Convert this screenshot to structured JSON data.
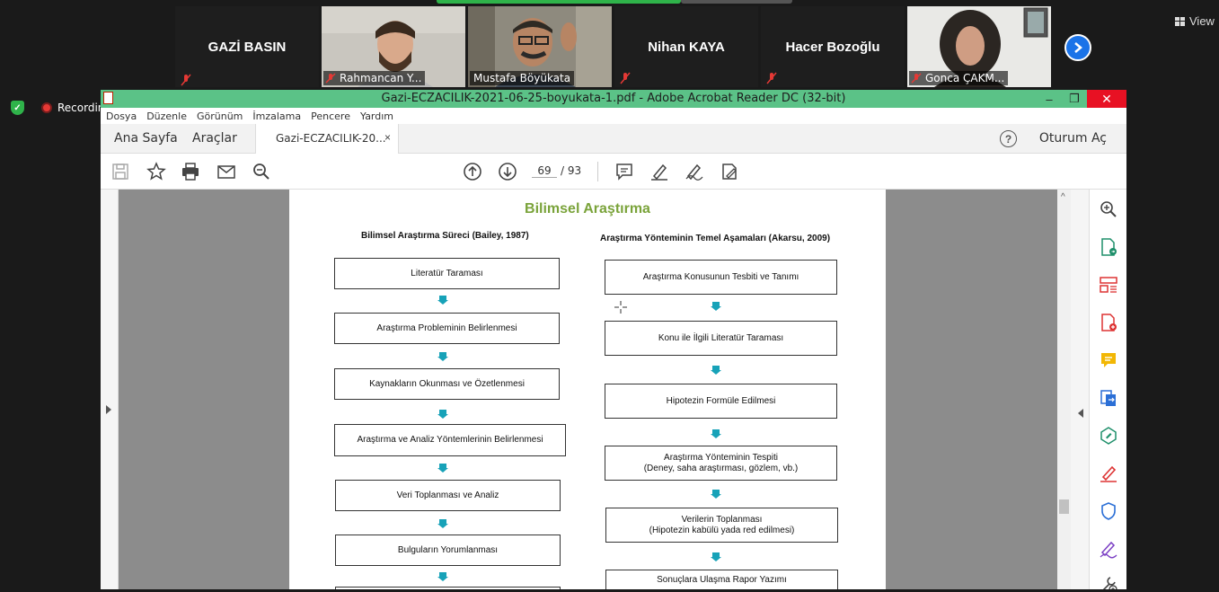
{
  "zoom": {
    "participants": [
      {
        "name": "GAZİ BASIN",
        "type": "name-only"
      },
      {
        "name": "Rahmancan Y...",
        "type": "video",
        "muted": true
      },
      {
        "name": "Mustafa Böyükata",
        "type": "video",
        "active": true
      },
      {
        "name": "Nihan KAYA",
        "type": "name-only",
        "muted": true
      },
      {
        "name": "Hacer Bozoğlu",
        "type": "name-only",
        "muted": true
      },
      {
        "name": "Gonca ÇAKM...",
        "type": "video",
        "muted": true
      }
    ],
    "view_label": "View",
    "recording_label": "Recording"
  },
  "window": {
    "title": "Gazi-ECZACILIK-2021-06-25-boyukata-1.pdf - Adobe Acrobat Reader DC (32-bit)",
    "minimize": "–",
    "restore": "❐",
    "close": "✕"
  },
  "menu": [
    "Dosya",
    "Düzenle",
    "Görünüm",
    "İmzalama",
    "Pencere",
    "Yardım"
  ],
  "tabs": {
    "home": "Ana Sayfa",
    "tools": "Araçlar",
    "document": "Gazi-ECZACILIK-20...",
    "close": "×",
    "help": "?",
    "signin": "Oturum Aç"
  },
  "toolbar": {
    "page_current": "69",
    "page_total": "/ 93"
  },
  "document": {
    "title": "Bilimsel Araştırma",
    "left_heading": "Bilimsel Araştırma Süreci (Bailey, 1987)",
    "right_heading": "Araştırma Yönteminin Temel Aşamaları (Akarsu, 2009)",
    "left_steps": [
      "Literatür Taraması",
      "Araştırma Probleminin Belirlenmesi",
      "Kaynakların Okunması ve Özetlenmesi",
      "Araştırma ve Analiz Yöntemlerinin Belirlenmesi",
      "Veri Toplanması ve Analiz",
      "Bulguların Yorumlanması"
    ],
    "right_steps": [
      {
        "line1": "Araştırma Konusunun Tesbiti ve Tanımı",
        "line2": ""
      },
      {
        "line1": "Konu ile İlgili Literatür Taraması",
        "line2": ""
      },
      {
        "line1": "Hipotezin Formüle Edilmesi",
        "line2": ""
      },
      {
        "line1": "Araştırma Yönteminin Tespiti",
        "line2": "(Deney, saha araştırması, gözlem, vb.)"
      },
      {
        "line1": "Verilerin Toplanması",
        "line2": "(Hipotezin kabülü yada red edilmesi)"
      },
      {
        "line1": "Sonuçlara Ulaşma Rapor Yazımı",
        "line2": ""
      }
    ]
  },
  "colors": {
    "titlebar": "#5bc287",
    "doc_title": "#7aa33a",
    "arrow": "#17a2b8",
    "zoom_bg": "#1a1a1a"
  }
}
